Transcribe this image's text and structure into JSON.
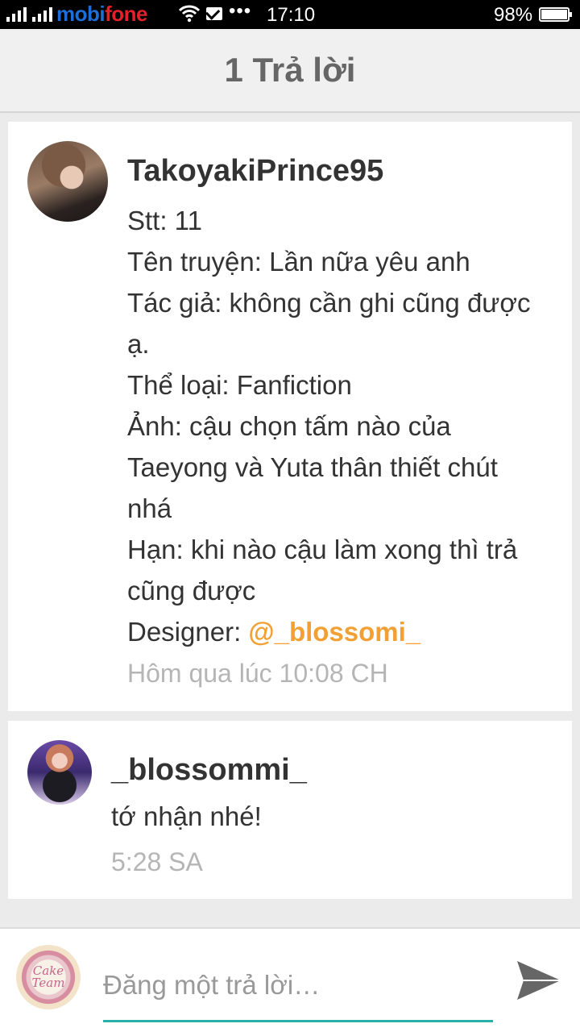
{
  "status_bar": {
    "carrier_mobi": "mobi",
    "carrier_fone": "fone",
    "dots": "•••",
    "time": "17:10",
    "battery": "98%"
  },
  "header": {
    "title": "1 Trả lời"
  },
  "post": {
    "username": "TakoyakiPrince95",
    "lines": [
      "Stt: 11",
      "Tên truyện: Lần nữa yêu anh",
      "Tác giả: không cần ghi cũng được",
      "ạ.",
      "Thể loại: Fanfiction",
      "Ảnh: cậu chọn tấm nào của",
      "Taeyong và Yuta thân thiết chút",
      "nhá",
      "Hạn: khi nào cậu làm xong thì trả",
      "cũng được"
    ],
    "designer_label": "Designer: ",
    "designer_mention": "@_blossomi_",
    "timestamp": "Hôm qua lúc 10:08 CH"
  },
  "reply": {
    "username": "_blossommi_",
    "text": "tớ nhận nhé!",
    "timestamp": "5:28 SA"
  },
  "composer": {
    "placeholder": "Đăng một trả lời…",
    "logo_text": "Cake Team",
    "accent_color": "#2ab0a6"
  },
  "colors": {
    "mention": "#f2a033",
    "timestamp": "#b5b5b5"
  }
}
